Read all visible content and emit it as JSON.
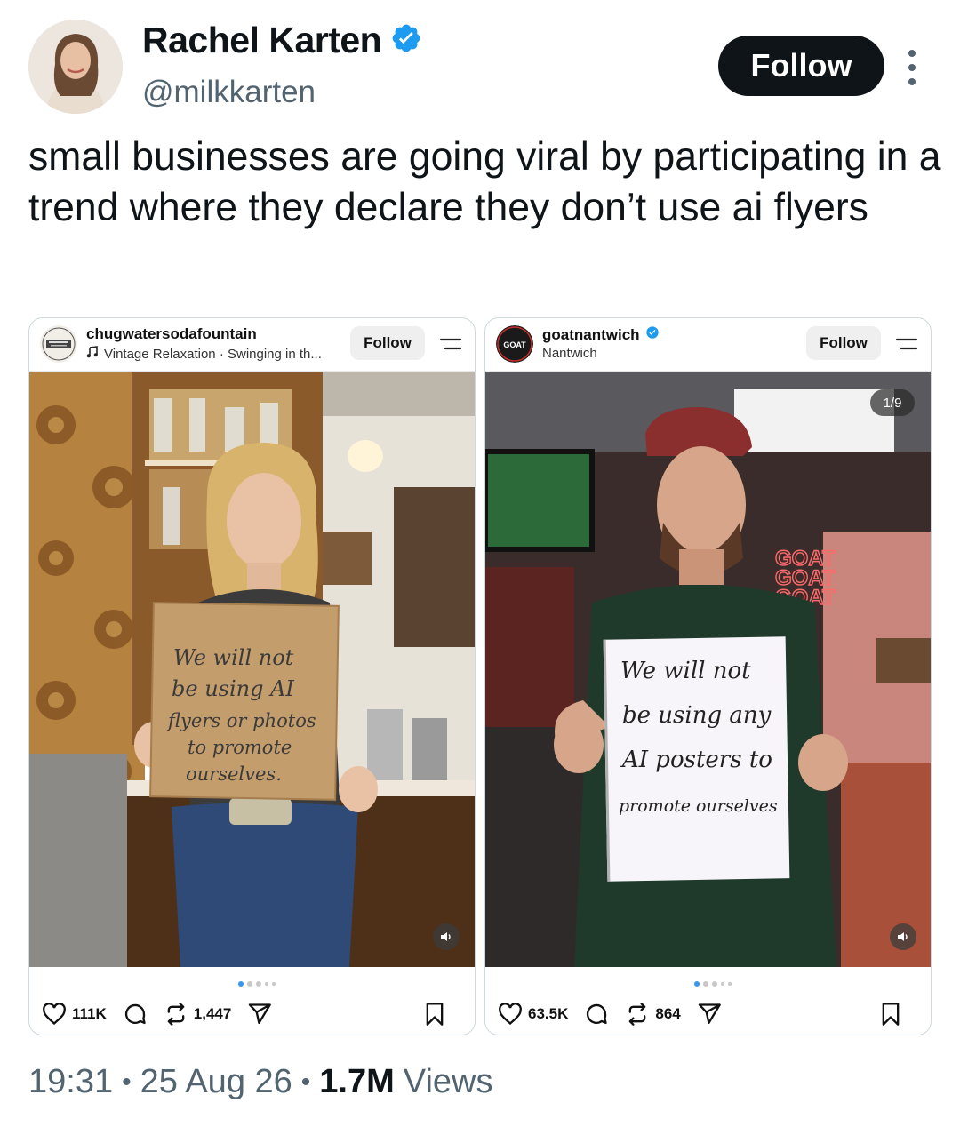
{
  "tweet": {
    "author": {
      "display_name": "Rachel Karten",
      "handle": "@milkkarten",
      "verified": true,
      "verified_color": "#1d9bf0"
    },
    "follow_label": "Follow",
    "text": "small businesses are going viral by participating in a trend where they declare they don’t use ai flyers",
    "footer": {
      "time": "19:31",
      "date": "25 Aug 26",
      "views_count": "1.7M",
      "views_label": "Views"
    }
  },
  "embeds": [
    {
      "username": "chugwatersodafountain",
      "audio": "Vintage Relaxation · Swinging in th...",
      "follow_label": "Follow",
      "sign_lines": [
        "We will not",
        "be using AI",
        "flyers or photos",
        "to promote",
        "ourselves."
      ],
      "likes": "111K",
      "reposts": "1,447",
      "carousel_count": 5
    },
    {
      "username": "goatnantwich",
      "verified": true,
      "location": "Nantwich",
      "avatar_text": "GOAT",
      "follow_label": "Follow",
      "page_indicator": "1/9",
      "neon_sign": "GOAT",
      "sign_lines": [
        "We will not",
        "be using any",
        "AI posters to",
        "promote ourselves"
      ],
      "likes": "63.5K",
      "reposts": "864",
      "carousel_count": 5
    }
  ]
}
